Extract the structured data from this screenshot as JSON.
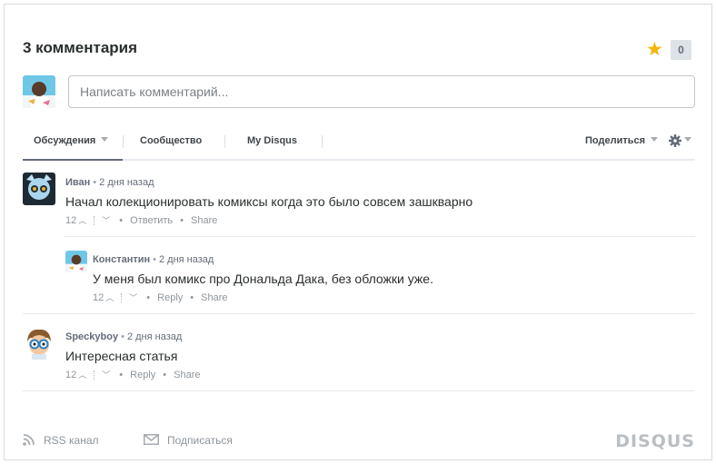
{
  "header": {
    "count_title": "3 комментария",
    "recommend_count": "0"
  },
  "composer": {
    "placeholder": "Написать комментарий..."
  },
  "tabs": {
    "discussion": "Обсуждения",
    "community": "Сообщество",
    "my_disqus": "My Disqus",
    "share": "Поделиться"
  },
  "posts": [
    {
      "author": "Иван",
      "time": "2 дня назад",
      "message": "Начал колекционировать комиксы когда это было совсем зашкварно",
      "votes": "12",
      "reply_label": "Ответить",
      "share_label": "Share"
    },
    {
      "author": "Константин",
      "time": "2 дня назад",
      "message": "У меня был комикс про Дональда Дака, без обложки уже.",
      "votes": "12",
      "reply_label": "Reply",
      "share_label": "Share"
    },
    {
      "author": "Speckyboy",
      "time": "2  дня назад",
      "message": "Интересная статья",
      "votes": "12",
      "reply_label": "Reply",
      "share_label": "Share"
    }
  ],
  "footer": {
    "rss": "RSS канал",
    "subscribe": "Подписаться",
    "brand": "DISQUS"
  },
  "colors": {
    "star": "#f5b500",
    "text": "#2a2e2e",
    "muted": "#656c7a",
    "brand_logo": "#b9bec2"
  },
  "icons": [
    "star-icon",
    "caret-down-icon",
    "gear-icon",
    "rss-icon",
    "envelope-icon",
    "vote-up-icon",
    "vote-down-icon"
  ]
}
